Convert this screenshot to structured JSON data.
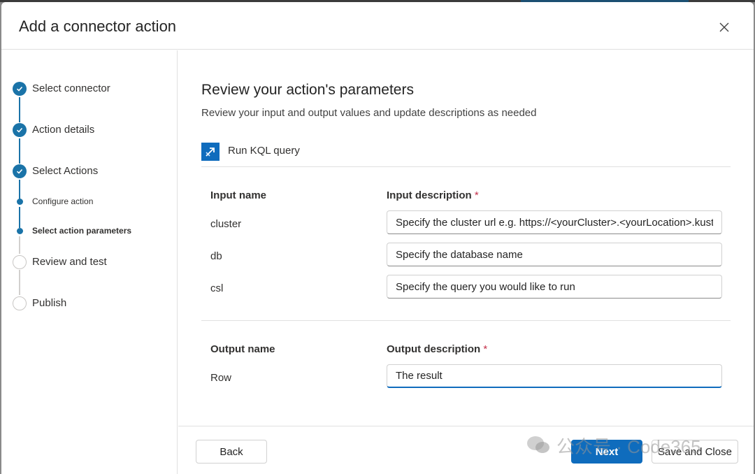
{
  "dialog": {
    "title": "Add a connector action"
  },
  "steps": {
    "select_connector": "Select connector",
    "action_details": "Action details",
    "select_actions": "Select Actions",
    "configure_action": "Configure action",
    "select_action_parameters": "Select action parameters",
    "review_and_test": "Review and test",
    "publish": "Publish"
  },
  "main": {
    "title": "Review your action's parameters",
    "subtitle": "Review your input and output values and update descriptions as needed",
    "action_name": "Run KQL query"
  },
  "inputs": {
    "name_header": "Input name",
    "description_header": "Input description",
    "rows": [
      {
        "name": "cluster",
        "description": "Specify the cluster url e.g. https://<yourCluster>.<yourLocation>.kusto"
      },
      {
        "name": "db",
        "description": "Specify the database name"
      },
      {
        "name": "csl",
        "description": "Specify the query you would like to run"
      }
    ]
  },
  "outputs": {
    "name_header": "Output name",
    "description_header": "Output description",
    "rows": [
      {
        "name": "Row",
        "description": "The result"
      }
    ]
  },
  "required_marker": "*",
  "footer": {
    "back": "Back",
    "next": "Next",
    "save_close": "Save and Close"
  },
  "watermark": "公众号 · Code365",
  "colors": {
    "accent": "#0f6cbd",
    "step_done": "#1a73a8",
    "required": "#c4314b"
  }
}
